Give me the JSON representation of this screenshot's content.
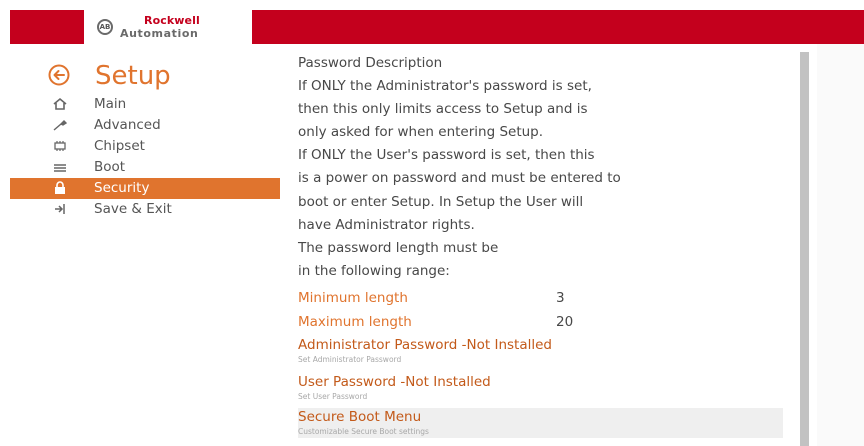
{
  "brand": {
    "line1": "Rockwell",
    "line2": "Automation",
    "mark": "AB",
    "accent": "#c4001d"
  },
  "header": {
    "title": "Setup",
    "back_icon": "back-arrow-circle-icon"
  },
  "colors": {
    "accent": "#e0742e",
    "text": "#484848"
  },
  "menu": {
    "items": [
      {
        "label": "Main",
        "icon": "home-icon",
        "active": false
      },
      {
        "label": "Advanced",
        "icon": "wrench-icon",
        "active": false
      },
      {
        "label": "Chipset",
        "icon": "chip-icon",
        "active": false
      },
      {
        "label": "Boot",
        "icon": "boot-drive-icon",
        "active": false
      },
      {
        "label": "Security",
        "icon": "lock-icon",
        "active": true
      },
      {
        "label": "Save & Exit",
        "icon": "exit-icon",
        "active": false
      }
    ]
  },
  "content": {
    "description": [
      "Password Description",
      "If ONLY the Administrator's password is set,",
      "then this only limits access to Setup and is",
      "only asked for when entering Setup.",
      "If ONLY the User's password is set, then this",
      "is a power on password and must be entered to",
      "boot or enter Setup. In Setup the User will",
      "have Administrator rights.",
      "The password length must be",
      "in the following range:"
    ],
    "min_length": {
      "label": "Minimum length",
      "value": "3"
    },
    "max_length": {
      "label": "Maximum length",
      "value": "20"
    },
    "options": [
      {
        "title": "Administrator Password -Not Installed",
        "subtitle": "Set Administrator Password"
      },
      {
        "title": "User Password -Not Installed",
        "subtitle": "Set User Password"
      },
      {
        "title": "Secure Boot Menu",
        "subtitle": "Customizable Secure Boot settings"
      }
    ]
  }
}
